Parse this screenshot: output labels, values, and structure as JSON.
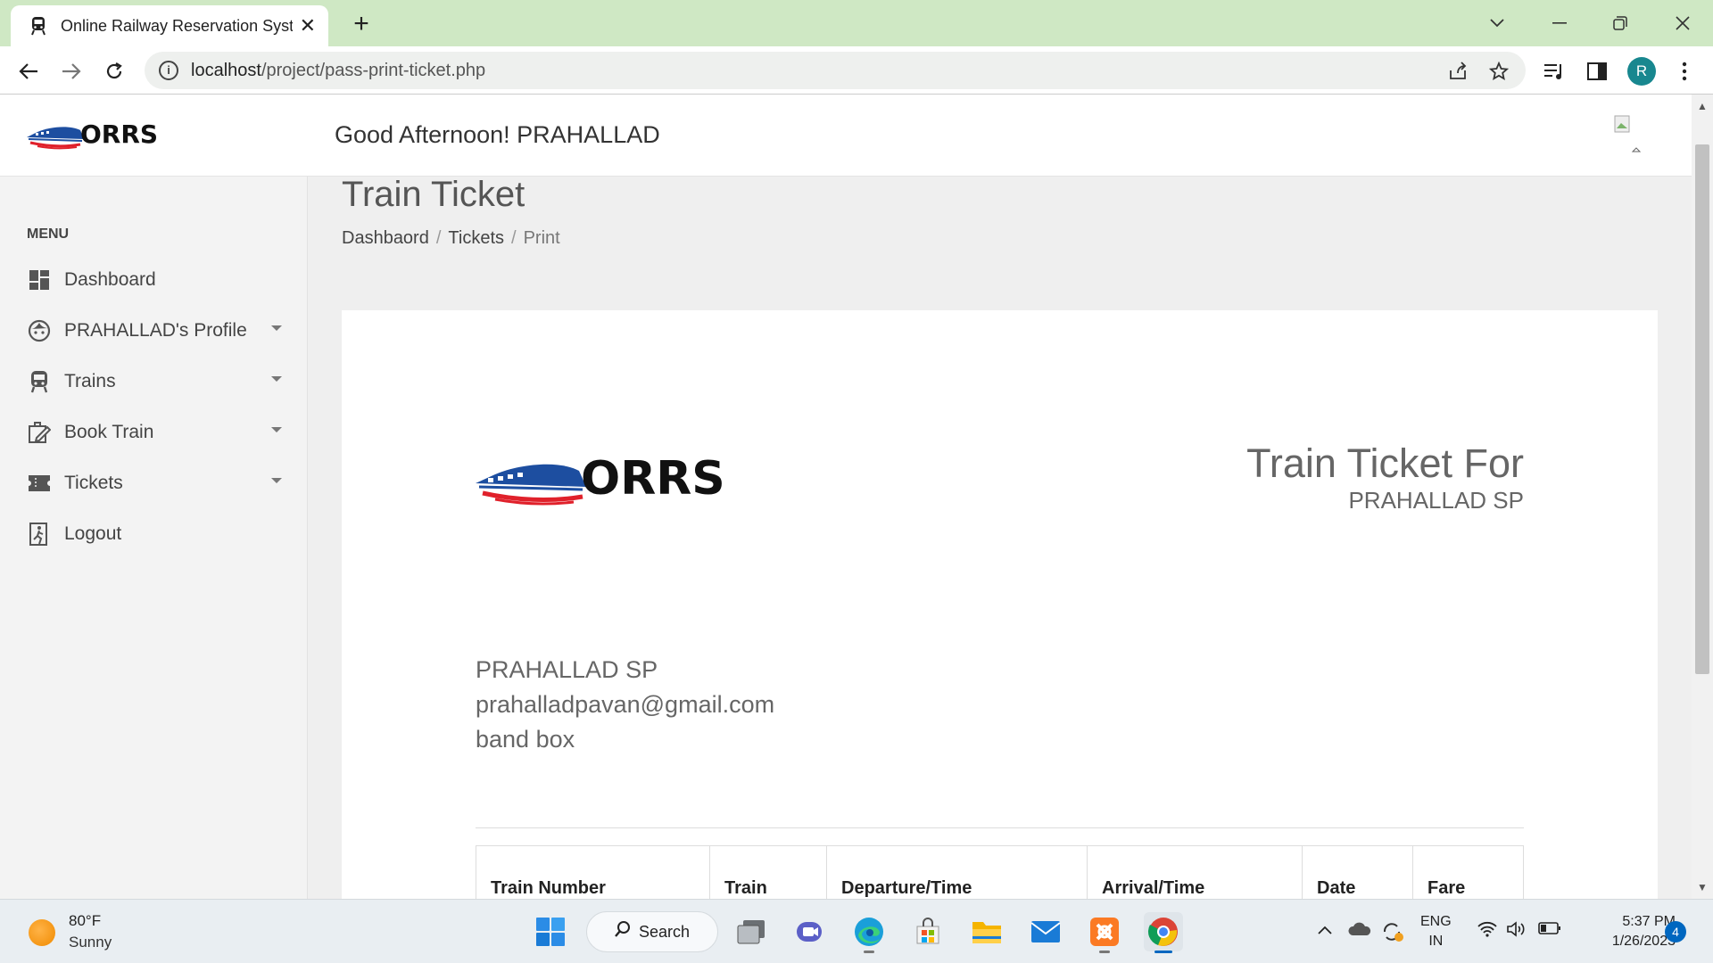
{
  "browser": {
    "tab_title": "Online Railway Reservation System",
    "url_host": "localhost",
    "url_path": "/project/pass-print-ticket.php",
    "profile_initial": "R"
  },
  "header": {
    "logo_text": "ORRS",
    "greeting": "Good Afternoon! PRAHALLAD"
  },
  "sidebar": {
    "heading": "MENU",
    "items": [
      {
        "label": "Dashboard",
        "icon": "dashboard-icon",
        "has_caret": false
      },
      {
        "label": "PRAHALLAD's Profile",
        "icon": "face-icon",
        "has_caret": true
      },
      {
        "label": "Trains",
        "icon": "train-icon",
        "has_caret": true
      },
      {
        "label": "Book Train",
        "icon": "edit-icon",
        "has_caret": true
      },
      {
        "label": "Tickets",
        "icon": "ticket-icon",
        "has_caret": true
      },
      {
        "label": "Logout",
        "icon": "exit-icon",
        "has_caret": false
      }
    ]
  },
  "content": {
    "page_title": "Train Ticket",
    "breadcrumb": [
      "Dashbaord",
      "Tickets",
      "Print"
    ]
  },
  "ticket": {
    "logo_text": "ORRS",
    "title": "Train Ticket For",
    "for_name": "PRAHALLAD SP",
    "passenger": {
      "name": "PRAHALLAD SP",
      "email": "prahalladpavan@gmail.com",
      "address": "band box"
    },
    "table_headers": [
      "Train Number",
      "Train",
      "Departure/Time",
      "Arrival/Time",
      "Date",
      "Fare"
    ]
  },
  "taskbar": {
    "weather_temp": "80°F",
    "weather_condition": "Sunny",
    "search_label": "Search",
    "lang_line1": "ENG",
    "lang_line2": "IN",
    "time": "5:37 PM",
    "date": "1/26/2023",
    "notification_count": "4"
  },
  "colors": {
    "tabbar_bg": "#cfe8c4",
    "logo_blue": "#1d4ea0",
    "logo_red": "#e0212b",
    "avatar_teal": "#18878f"
  }
}
